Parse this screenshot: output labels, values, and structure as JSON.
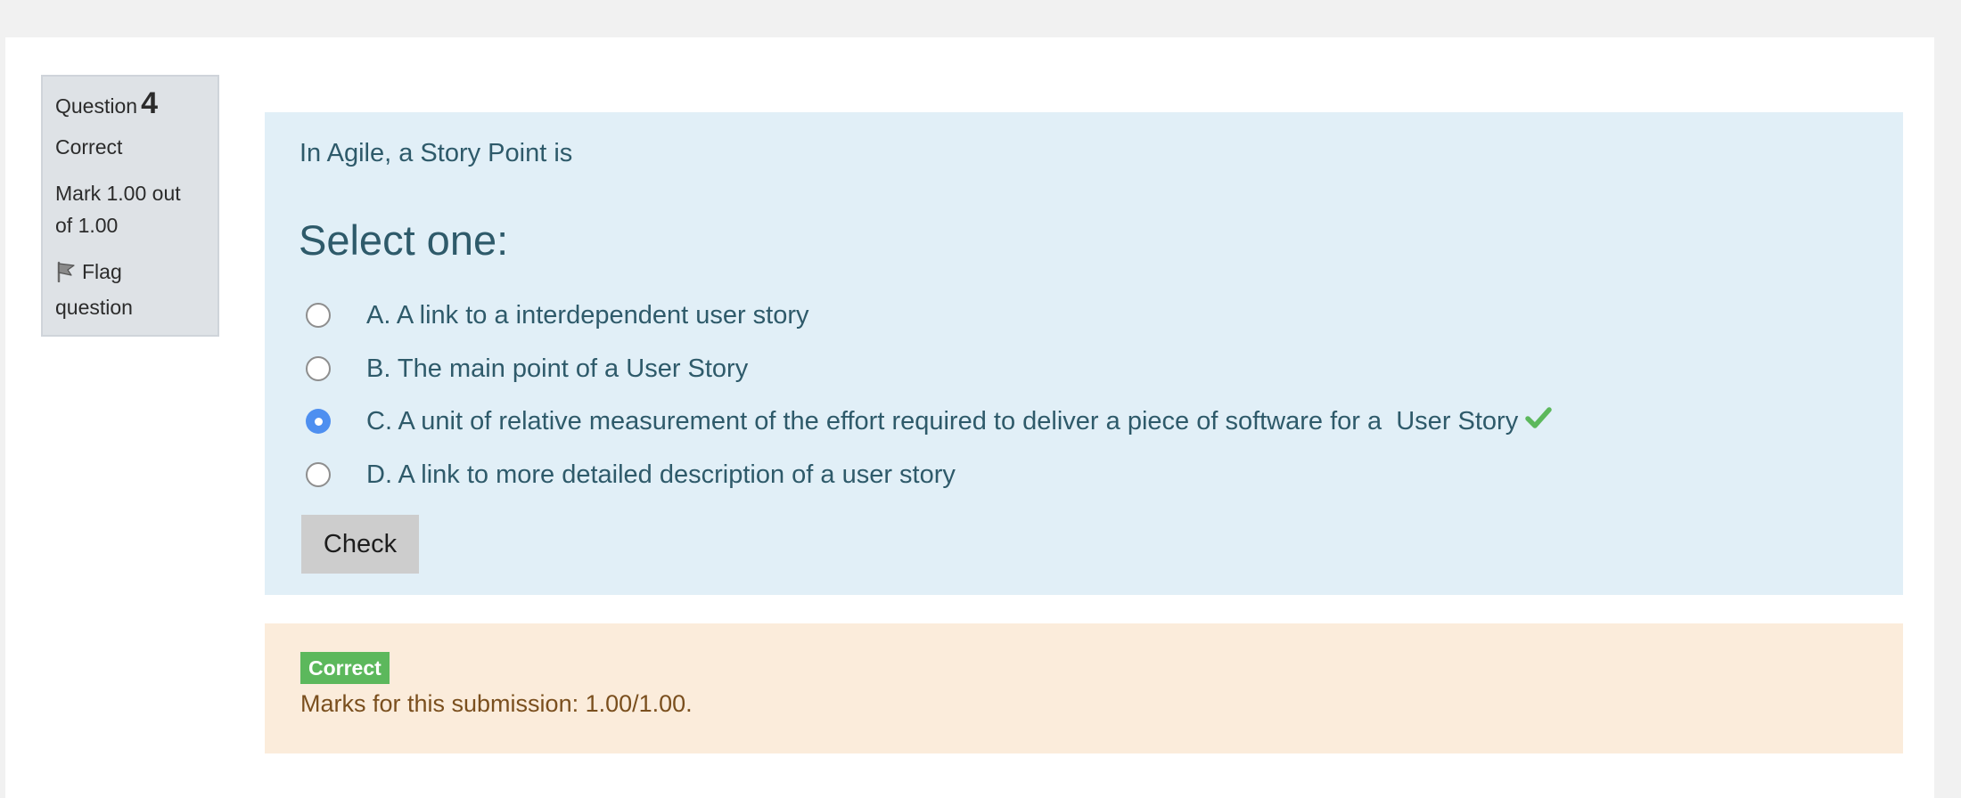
{
  "question_info": {
    "label": "Question",
    "number": "4",
    "state": "Correct",
    "grade_line1": "Mark 1.00 out",
    "grade_line2": "of 1.00",
    "flag_line1": "Flag",
    "flag_line2": "question"
  },
  "question": {
    "text": "In Agile, a Story Point is",
    "prompt": "Select one:",
    "answers": [
      {
        "text": "A. A link to a interdependent user story",
        "selected": false
      },
      {
        "text": "B. The main point of a User Story",
        "selected": false
      },
      {
        "text": "C. A unit of relative measurement of the effort required to deliver a piece of software for a  User Story",
        "selected": true,
        "correct_icon": "check-icon"
      },
      {
        "text": "D. A link to more detailed description of a user story",
        "selected": false
      }
    ],
    "check_label": "Check"
  },
  "outcome": {
    "badge": "Correct",
    "marks": "Marks for this submission: 1.00/1.00."
  },
  "colors": {
    "info_bg": "#dee2e6",
    "formulation_bg": "#e1eff7",
    "outcome_bg": "#fbecdb",
    "correct_green": "#5cb85c",
    "radio_selected": "#4e8ff0"
  }
}
